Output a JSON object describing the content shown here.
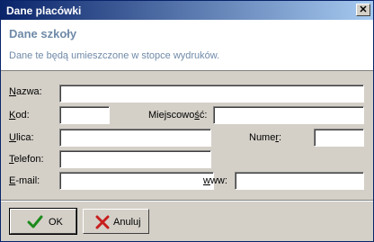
{
  "window": {
    "title": "Dane placówki",
    "close_glyph": "✕"
  },
  "header": {
    "title": "Dane szkoły",
    "description": "Dane te będą umieszczone w stopce wydruków."
  },
  "form": {
    "nazwa": {
      "label_key": "N",
      "label_rest": "azwa:",
      "value": ""
    },
    "kod": {
      "label_key": "K",
      "label_rest": "od:",
      "value": ""
    },
    "miejscowosc": {
      "label_pre": "Miejscowo",
      "label_key": "ś",
      "label_rest": "ć:",
      "value": ""
    },
    "ulica": {
      "label_key": "U",
      "label_rest": "lica:",
      "value": ""
    },
    "numer": {
      "label_pre": "Nume",
      "label_key": "r",
      "label_rest": ":",
      "value": ""
    },
    "telefon": {
      "label_key": "T",
      "label_rest": "elefon:",
      "value": ""
    },
    "email": {
      "label_key": "E",
      "label_rest": "-mail:",
      "value": ""
    },
    "www": {
      "label_key": "w",
      "label_rest": "ww:",
      "value": ""
    }
  },
  "buttons": {
    "ok": "OK",
    "cancel": "Anuluj"
  },
  "icons": {
    "ok": "checkmark-icon",
    "cancel": "x-mark-icon",
    "ok_color": "#1c8a1c",
    "cancel_color": "#c81e1e"
  }
}
